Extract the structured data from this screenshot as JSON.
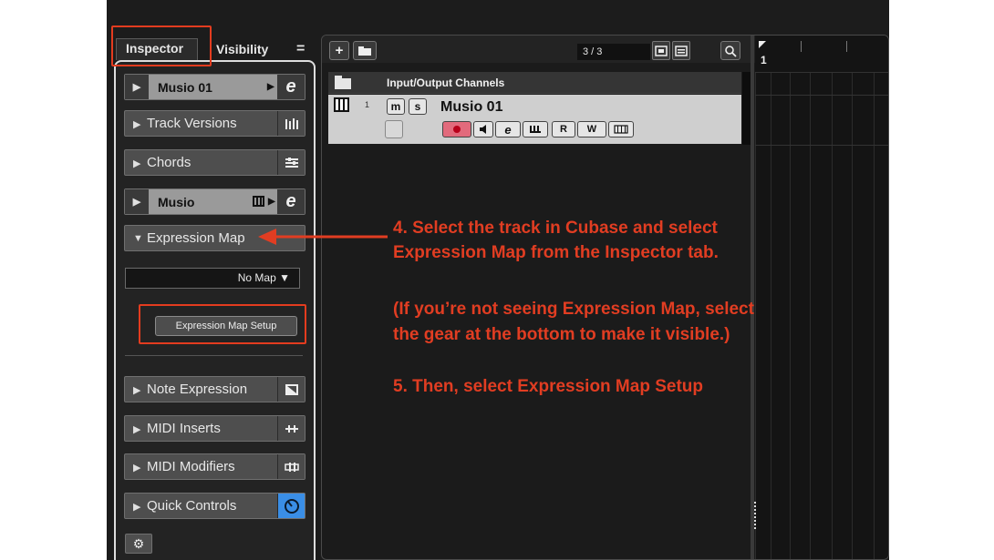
{
  "inspector_tabs": {
    "inspector": "Inspector",
    "visibility": "Visibility",
    "menu": "="
  },
  "inspector": {
    "track_header": "Musio 01",
    "sections": {
      "track_versions": "Track Versions",
      "chords": "Chords",
      "musio": "Musio",
      "expression_map": "Expression Map",
      "note_expression": "Note Expression",
      "midi_inserts": "MIDI Inserts",
      "midi_modifiers": "MIDI Modifiers",
      "quick_controls": "Quick Controls"
    },
    "expression_map_value": "No Map",
    "setup_button": "Expression Map Setup"
  },
  "project": {
    "counter": "3 / 3",
    "folder_track": "Input/Output Channels",
    "track_number": "1",
    "track_name": "Musio 01",
    "mute": "m",
    "solo": "s",
    "ruler_bar": "1",
    "track_buttons": {
      "read": "R",
      "write": "W"
    }
  },
  "annotations": {
    "line1": "4. Select the track in Cubase and select",
    "line2": "Expression Map from the Inspector tab.",
    "line3": "(If you’re not seeing Expression Map, select",
    "line4": "the gear at the bottom to make it visible.)",
    "line5": "5. Then, select Expression Map Setup"
  },
  "colors": {
    "annotation": "#e13d22",
    "record": "#e0263b",
    "quick_controls_accent": "#3a8ee6"
  },
  "icons": [
    "plus-icon",
    "folder-add-icon",
    "zoom-icon",
    "list-icon",
    "search-icon",
    "edit-e-icon",
    "track-versions-icon",
    "chords-icon",
    "piano-icon",
    "note-expression-icon",
    "midi-inserts-icon",
    "midi-modifiers-icon",
    "quick-controls-knob-icon",
    "gear-icon"
  ]
}
